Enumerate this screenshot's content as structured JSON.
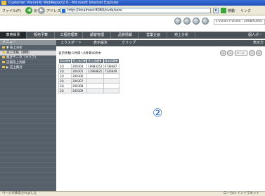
{
  "window": {
    "title": "Customer Vision(R) WebReport2.0 - Microsoft Internet Explorer"
  },
  "browser": {
    "menu": "ファイル(F)",
    "back_label": "戻る",
    "back_icon": "arrow-left-icon",
    "forward_icon": "arrow-right-icon",
    "address_label": "アドレス(D)",
    "address_url": "http://localhost:8080/cvds/serv",
    "go_label": "移動",
    "links_label": "リンク"
  },
  "app": {
    "user_info": "c-vision c-vision : 2008/03/05"
  },
  "tabs": [
    {
      "label": "表格帳票"
    },
    {
      "label": "販売予算"
    },
    {
      "label": "工程管理表"
    },
    {
      "label": "顧客管理"
    },
    {
      "label": "品質情報"
    },
    {
      "label": "営業企画"
    },
    {
      "label": "売上分析"
    }
  ],
  "tabs_right": "個人ポータ",
  "sidebar": {
    "header": "メニュー",
    "items": [
      {
        "label": "▼ 売上分析"
      },
      {
        "label": "売上実績（期間）"
      },
      {
        "label": "集計データ（エリア）"
      },
      {
        "label": "店舗売上実績"
      },
      {
        "label": "▶ 売上集計"
      }
    ]
  },
  "toolbar": {
    "buttons": [
      {
        "label": "エクスポート"
      },
      {
        "label": "表示設定"
      },
      {
        "label": "クリップ"
      }
    ],
    "right": "表示方"
  },
  "main": {
    "info_text": "表示件数:1件目〜6件目/6件中",
    "pager": {
      "first_icon": "first-page-icon",
      "prev_icon": "prev-page-icon",
      "page_value": "ページ",
      "next_icon": "next-page-icon",
      "last_icon": "last-page-icon"
    },
    "table": {
      "headers": [
        "四半期▼",
        "売上年月▼",
        "売上金額▼",
        "前年同期▼"
      ],
      "rows": [
        [
          "1Q",
          "200304",
          "16983252",
          "4738487"
        ],
        [
          "1Q",
          "200305",
          "12968625",
          "7126649"
        ],
        [
          "1Q",
          "200306",
          "",
          ""
        ],
        [
          "2Q",
          "200307",
          "",
          ""
        ],
        [
          "2Q",
          "200308",
          "",
          ""
        ],
        [
          "2Q",
          "200309",
          "",
          ""
        ]
      ]
    }
  },
  "annotation": "②",
  "status": {
    "left": "ページが表示されました",
    "right": "ローカル イントラネット"
  }
}
